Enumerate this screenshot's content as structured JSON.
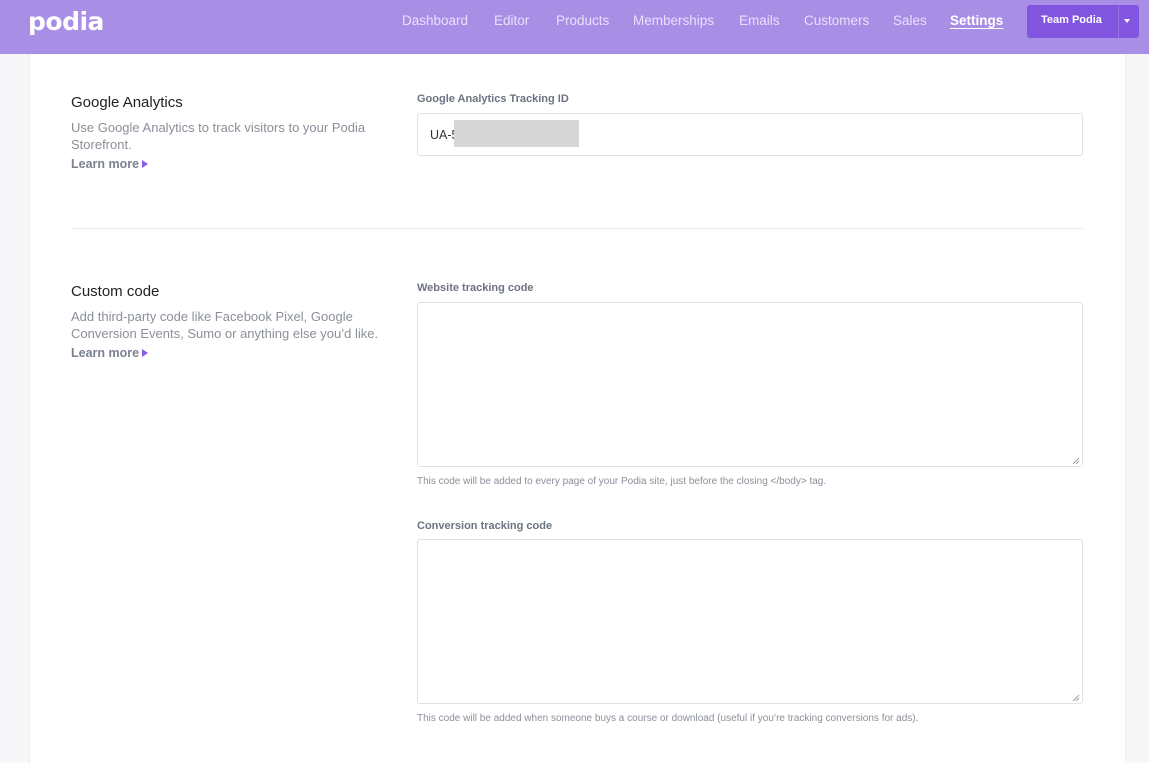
{
  "header": {
    "logo": "podia",
    "nav": [
      {
        "label": "Dashboard"
      },
      {
        "label": "Editor"
      },
      {
        "label": "Products"
      },
      {
        "label": "Memberships"
      },
      {
        "label": "Emails"
      },
      {
        "label": "Customers"
      },
      {
        "label": "Sales"
      },
      {
        "label": "Settings",
        "active": true
      }
    ],
    "team_button": "Team Podia",
    "team_caret_icon": "caret-down-icon"
  },
  "google_analytics": {
    "title": "Google Analytics",
    "description": "Use Google Analytics to track visitors to your Podia Storefront.",
    "learn_more": "Learn more",
    "field_label": "Google Analytics Tracking ID",
    "tracking_id_value": "UA-5"
  },
  "custom_code": {
    "title": "Custom code",
    "description": "Add third-party code like Facebook Pixel, Google Conversion Events, Sumo or anything else you’d like.",
    "learn_more": "Learn more",
    "website_label": "Website tracking code",
    "website_value": "",
    "website_help": "This code will be added to every page of your Podia site, just before the closing </body> tag.",
    "conversion_label": "Conversion tracking code",
    "conversion_value": "",
    "conversion_help": "This code will be added when someone buys a course or download (useful if you’re tracking conversions for ads)."
  },
  "colors": {
    "header_bg": "#a98ee6",
    "accent": "#8155e0",
    "arrow": "#8a5ce6"
  }
}
